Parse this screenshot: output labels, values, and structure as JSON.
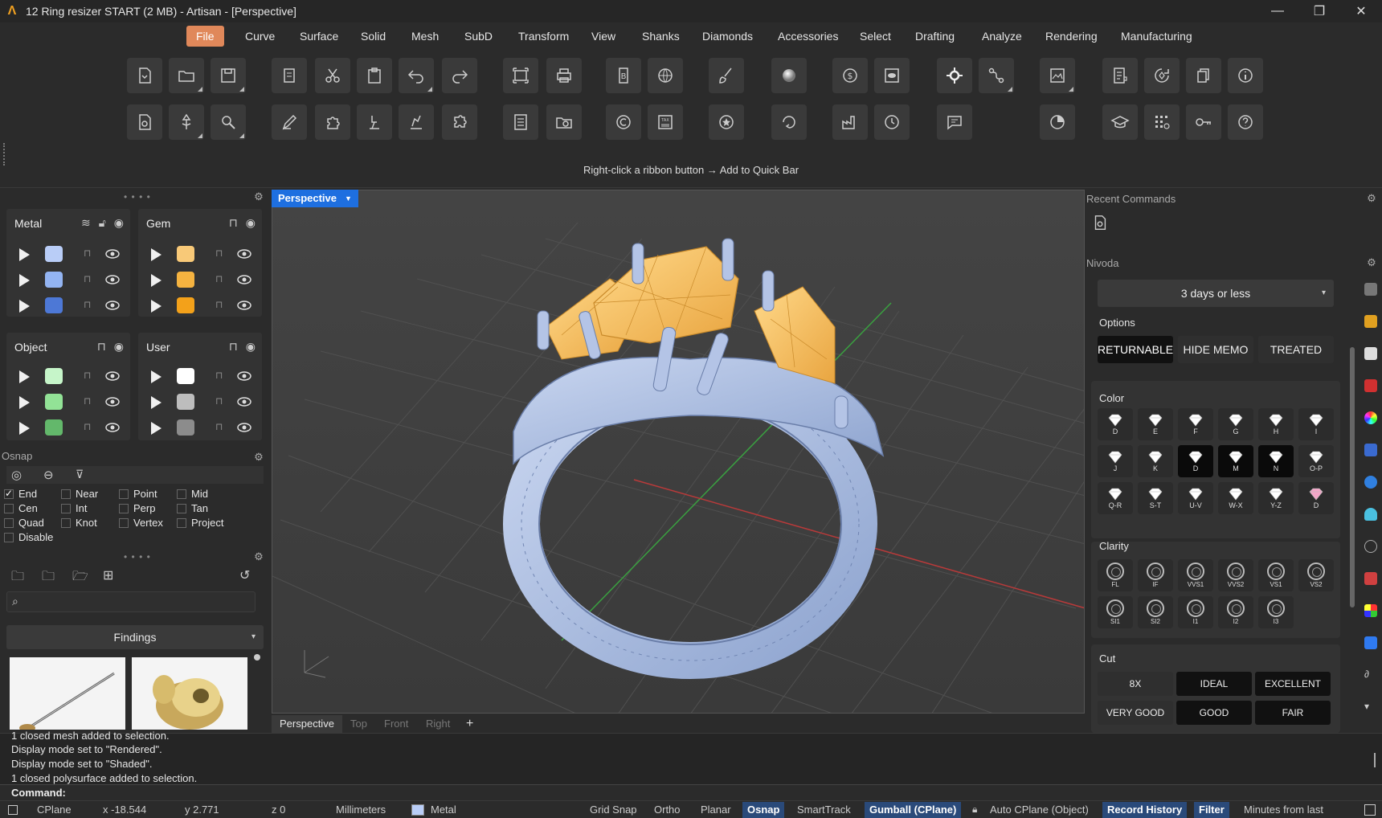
{
  "window": {
    "title": "12 Ring resizer START (2 MB) - Artisan - [Perspective]",
    "minimize": "—",
    "restore": "❐",
    "close": "✕"
  },
  "menu": [
    "File",
    "Curve",
    "Surface",
    "Solid",
    "Mesh",
    "SubD",
    "Transform",
    "View",
    "Shanks",
    "Diamonds",
    "Accessories",
    "Select",
    "Drafting",
    "Analyze",
    "Rendering",
    "Manufacturing"
  ],
  "ribbon": {
    "hint": "Right-click a ribbon button → Add to Quick Bar"
  },
  "layers": {
    "metal": {
      "title": "Metal",
      "colors": [
        "#b9cdf7",
        "#93b4f2",
        "#4d78d6"
      ]
    },
    "gem": {
      "title": "Gem",
      "colors": [
        "#f8c978",
        "#f5b340",
        "#f3a11a"
      ]
    },
    "object": {
      "title": "Object",
      "colors": [
        "#c6f5c9",
        "#92e296",
        "#63b86b"
      ]
    },
    "user": {
      "title": "User",
      "colors": [
        "#ffffff",
        "#bdbdbd",
        "#8c8c8c"
      ]
    }
  },
  "osnap": {
    "title": "Osnap",
    "items": [
      {
        "label": "End",
        "checked": true
      },
      {
        "label": "Near",
        "checked": false
      },
      {
        "label": "Point",
        "checked": false
      },
      {
        "label": "Mid",
        "checked": false
      },
      {
        "label": "Cen",
        "checked": false
      },
      {
        "label": "Int",
        "checked": false
      },
      {
        "label": "Perp",
        "checked": false
      },
      {
        "label": "Tan",
        "checked": false
      },
      {
        "label": "Quad",
        "checked": false
      },
      {
        "label": "Knot",
        "checked": false
      },
      {
        "label": "Vertex",
        "checked": false
      },
      {
        "label": "Project",
        "checked": false
      },
      {
        "label": "Disable",
        "checked": false
      }
    ]
  },
  "library": {
    "search_placeholder": "",
    "category": "Findings"
  },
  "viewport": {
    "label": "Perspective",
    "tabs": [
      "Perspective",
      "Top",
      "Front",
      "Right",
      "+"
    ]
  },
  "right": {
    "recent_title": "Recent Commands",
    "nivoda_title": "Nivoda",
    "delivery": "3 days or less",
    "options_title": "Options",
    "options": [
      {
        "label": "RETURNABLE",
        "on": true
      },
      {
        "label": "HIDE MEMO",
        "on": false
      },
      {
        "label": "TREATED",
        "on": false
      }
    ],
    "color_title": "Color",
    "colors": [
      {
        "label": "D",
        "sel": false
      },
      {
        "label": "E",
        "sel": false
      },
      {
        "label": "F",
        "sel": false
      },
      {
        "label": "G",
        "sel": false
      },
      {
        "label": "H",
        "sel": false
      },
      {
        "label": "I",
        "sel": false
      },
      {
        "label": "J",
        "sel": false
      },
      {
        "label": "K",
        "sel": false
      },
      {
        "label": "D",
        "sel": true
      },
      {
        "label": "M",
        "sel": true
      },
      {
        "label": "N",
        "sel": true
      },
      {
        "label": "O-P",
        "sel": false
      },
      {
        "label": "Q-R",
        "sel": false
      },
      {
        "label": "S-T",
        "sel": false
      },
      {
        "label": "U-V",
        "sel": false
      },
      {
        "label": "W-X",
        "sel": false
      },
      {
        "label": "Y-Z",
        "sel": false
      },
      {
        "label": "D",
        "sel": false
      }
    ],
    "clarity_title": "Clarity",
    "clarity": [
      "FL",
      "IF",
      "VVS1",
      "VVS2",
      "VS1",
      "VS2",
      "SI1",
      "SI2",
      "I1",
      "I2",
      "I3"
    ],
    "cut_title": "Cut",
    "cut": [
      {
        "label": "8X",
        "on": false
      },
      {
        "label": "IDEAL",
        "on": true
      },
      {
        "label": "EXCELLENT",
        "on": true
      },
      {
        "label": "VERY GOOD",
        "on": false
      },
      {
        "label": "GOOD",
        "on": true
      },
      {
        "label": "FAIR",
        "on": true
      }
    ]
  },
  "command": {
    "history": [
      "1 closed mesh added to selection.",
      "Display mode set to \"Rendered\".",
      "Display mode set to \"Shaded\".",
      "1 closed polysurface added to selection."
    ],
    "prompt": "Command:"
  },
  "status": {
    "cplane": "CPlane",
    "x": "x -18.544",
    "y": "y 2.771",
    "z": "z 0",
    "units": "Millimeters",
    "layer": "Metal",
    "layer_color": "#b9cdf7",
    "grid_snap": "Grid Snap",
    "ortho": "Ortho",
    "planar": "Planar",
    "osnap": "Osnap",
    "smarttrack": "SmartTrack",
    "gumball": "Gumball (CPlane)",
    "auto_cplane": "Auto CPlane (Object)",
    "record_history": "Record History",
    "filter": "Filter",
    "minutes": "Minutes from last"
  }
}
